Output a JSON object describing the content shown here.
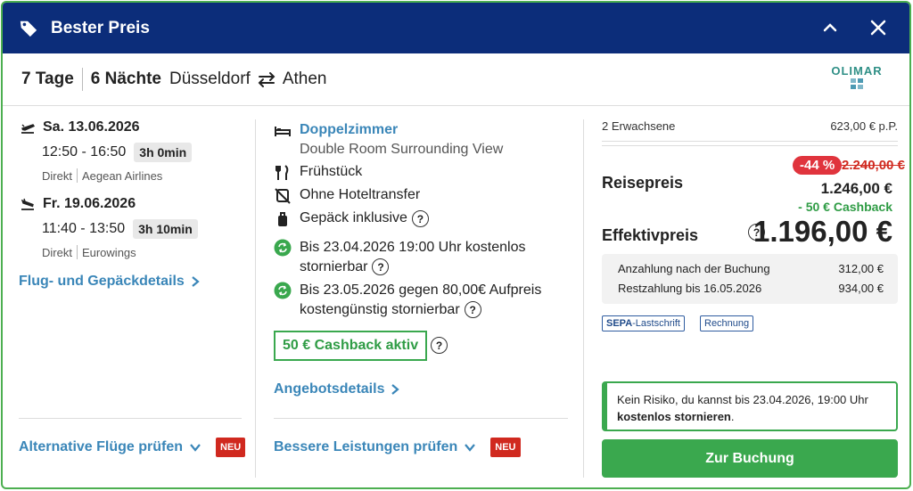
{
  "header": {
    "title": "Bester Preis",
    "collapse_icon": "chevron-up-icon",
    "close_icon": "close-icon",
    "background": "#0c2d7a"
  },
  "summary": {
    "days": "7 Tage",
    "nights": "6 Nächte",
    "origin": "Düsseldorf",
    "swap_icon": "swap-arrows-icon",
    "destination": "Athen"
  },
  "brand": {
    "name": "OLIMAR"
  },
  "flights": {
    "outbound": {
      "icon": "plane-departure-icon",
      "date": "Sa. 13.06.2026",
      "times": "12:50 - 16:50",
      "duration": "3h 0min",
      "type": "Direkt",
      "airline": "Aegean Airlines"
    },
    "return": {
      "icon": "plane-arrival-icon",
      "date": "Fr. 19.06.2026",
      "times": "11:40 - 13:50",
      "duration": "3h 10min",
      "type": "Direkt",
      "airline": "Eurowings"
    },
    "details_link": "Flug- und Gepäckdetails",
    "alternative_link": "Alternative Flüge prüfen",
    "new_badge": "NEU"
  },
  "hotel": {
    "room_title": "Doppelzimmer",
    "room_sub": "Double Room Surrounding View",
    "board": "Frühstück",
    "transfer": "Ohne Hoteltransfer",
    "luggage": "Gepäck inklusive",
    "cancel1_line1": "Bis 23.04.2026 19:00 Uhr kostenlos",
    "cancel1_line2": "stornierbar",
    "cancel2_line1": "Bis 23.05.2026 gegen 80,00€ Aufpreis",
    "cancel2_line2": "kostengünstig stornierbar",
    "cashback": "50 € Cashback aktiv",
    "details_link": "Angebotsdetails",
    "better_link": "Bessere Leistungen prüfen",
    "new_badge": "NEU",
    "question_mark": "?"
  },
  "price": {
    "pax": "2 Erwachsene",
    "per_person": "623,00 € p.P.",
    "discount": "-44 %",
    "old_price": "2.240,00 €",
    "reise_label": "Reisepreis",
    "reise_value": "1.246,00 €",
    "cashback_line": "- 50 € Cashback",
    "effektiv_label": "Effektivpreis",
    "effektiv_value": "1.196,00 €",
    "deposit_label": "Anzahlung nach der Buchung",
    "deposit_value": "312,00 €",
    "rest_label": "Restzahlung bis 16.05.2026",
    "rest_value": "934,00 €",
    "sepa_bold": "SEPA",
    "sepa_rest": "-Lastschrift",
    "invoice": "Rechnung",
    "info_text": "Kein Risiko, du kannst bis 23.04.2026, 19:00 Uhr",
    "info_bold": "kostenlos stornieren",
    "info_end": ".",
    "cta": "Zur Buchung",
    "accent_green": "#3aa84e",
    "discount_red": "#e0343d"
  }
}
